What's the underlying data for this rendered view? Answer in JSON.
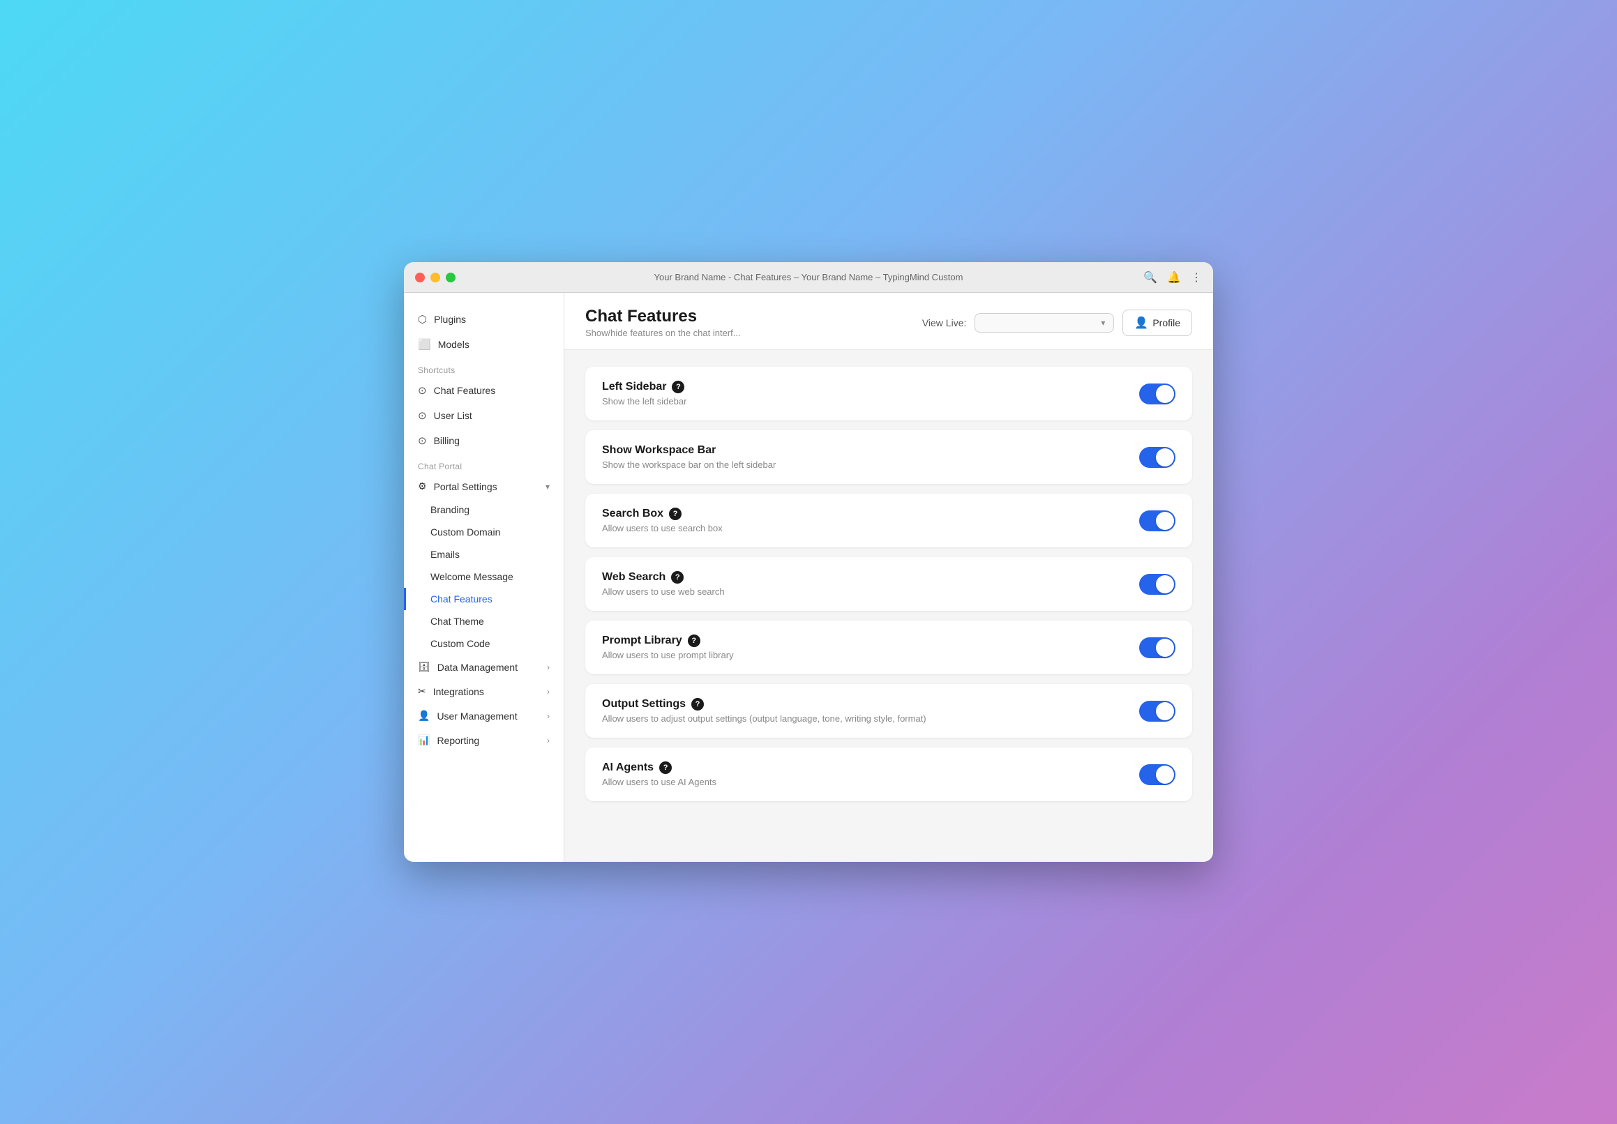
{
  "window": {
    "title": "Your Brand Name - Chat Features – Your Brand Name – TypingMind Custom"
  },
  "sidebar": {
    "top_items": [
      {
        "id": "plugins",
        "label": "Plugins",
        "icon": "🔌"
      },
      {
        "id": "models",
        "label": "Models",
        "icon": "🖥"
      }
    ],
    "shortcuts_label": "Shortcuts",
    "shortcuts": [
      {
        "id": "chat-features",
        "label": "Chat Features",
        "icon": "⏱"
      },
      {
        "id": "user-list",
        "label": "User List",
        "icon": "⏱"
      },
      {
        "id": "billing",
        "label": "Billing",
        "icon": "⏱"
      }
    ],
    "chat_portal_label": "Chat Portal",
    "portal_settings_label": "Portal Settings",
    "portal_sub_items": [
      {
        "id": "branding",
        "label": "Branding"
      },
      {
        "id": "custom-domain",
        "label": "Custom Domain"
      },
      {
        "id": "emails",
        "label": "Emails"
      },
      {
        "id": "welcome-message",
        "label": "Welcome Message"
      },
      {
        "id": "chat-features",
        "label": "Chat Features",
        "active": true
      },
      {
        "id": "chat-theme",
        "label": "Chat Theme"
      },
      {
        "id": "custom-code",
        "label": "Custom Code"
      }
    ],
    "main_menu": [
      {
        "id": "data-management",
        "label": "Data Management",
        "icon": "🗄",
        "has_arrow": true
      },
      {
        "id": "integrations",
        "label": "Integrations",
        "icon": "🔧",
        "has_arrow": true
      },
      {
        "id": "user-management",
        "label": "User Management",
        "icon": "👥",
        "has_arrow": true
      },
      {
        "id": "reporting",
        "label": "Reporting",
        "icon": "📊",
        "has_arrow": true
      }
    ]
  },
  "header": {
    "title": "Chat Features",
    "subtitle": "Show/hide features on the chat interf...",
    "view_live_label": "View Live:",
    "view_live_placeholder": "",
    "profile_label": "Profile"
  },
  "features": [
    {
      "id": "left-sidebar",
      "title": "Left Sidebar",
      "has_help": true,
      "description": "Show the left sidebar",
      "enabled": true
    },
    {
      "id": "show-workspace-bar",
      "title": "Show Workspace Bar",
      "has_help": false,
      "description": "Show the workspace bar on the left sidebar",
      "enabled": true
    },
    {
      "id": "search-box",
      "title": "Search Box",
      "has_help": true,
      "description": "Allow users to use search box",
      "enabled": true
    },
    {
      "id": "web-search",
      "title": "Web Search",
      "has_help": true,
      "description": "Allow users to use web search",
      "enabled": true
    },
    {
      "id": "prompt-library",
      "title": "Prompt Library",
      "has_help": true,
      "description": "Allow users to use prompt library",
      "enabled": true
    },
    {
      "id": "output-settings",
      "title": "Output Settings",
      "has_help": true,
      "description": "Allow users to adjust output settings (output language, tone, writing style, format)",
      "enabled": true
    },
    {
      "id": "ai-agents",
      "title": "AI Agents",
      "has_help": true,
      "description": "Allow users to use AI Agents",
      "enabled": true
    }
  ]
}
